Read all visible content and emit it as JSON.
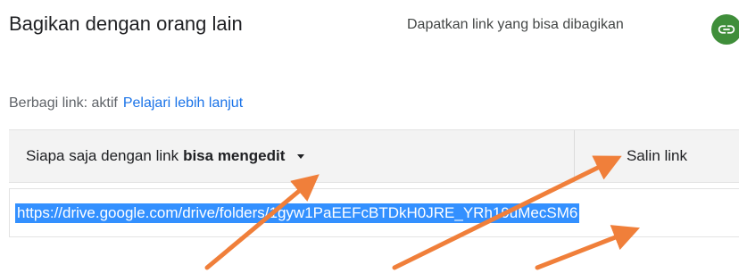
{
  "dialog": {
    "title": "Bagikan dengan orang lain",
    "get_link_label": "Dapatkan link yang bisa dibagikan",
    "link_button_color": "#3f8e3a"
  },
  "sharing": {
    "status": "Berbagi link: aktif",
    "learn_more": "Pelajari lebih lanjut"
  },
  "access": {
    "prefix": "Siapa saja dengan link",
    "permission": "bisa mengedit",
    "copy_link": "Salin link"
  },
  "link": {
    "url": "https://drive.google.com/drive/folders/1gyw1PaEEFcBTDkH0JRE_YRh19uMecSM6"
  },
  "annotation": {
    "arrow_color": "#f07f3a"
  }
}
